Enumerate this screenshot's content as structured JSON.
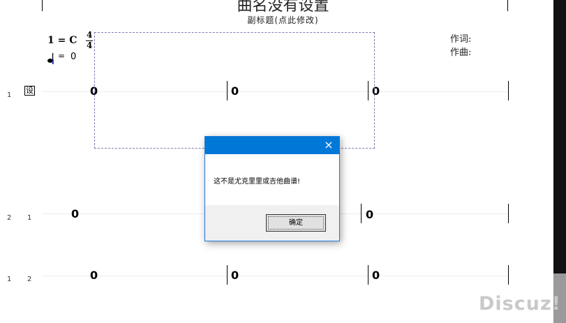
{
  "score": {
    "title": "曲名没有设置",
    "subtitle": "副标题(点此修改)",
    "key": "1 = C",
    "time_top": "4",
    "time_bottom": "4",
    "tempo_eq": "=",
    "tempo_value": "0",
    "lyricist_label": "作词:",
    "composer_label": "作曲:",
    "clef_mark": "设",
    "cursor_mark": "I"
  },
  "rows": [
    {
      "labels": [
        "1"
      ],
      "notes": [
        "0",
        "0",
        "0"
      ]
    },
    {
      "labels": [
        "2",
        "1"
      ],
      "notes": [
        "0",
        "0"
      ]
    },
    {
      "labels": [
        "1",
        "2"
      ],
      "notes": [
        "0",
        "0",
        "0"
      ]
    }
  ],
  "dialog": {
    "title": "",
    "close_icon": "×",
    "message": "这不是尤克里里或吉他曲谱!",
    "ok_label": "确定"
  },
  "watermark": "Discuz!"
}
